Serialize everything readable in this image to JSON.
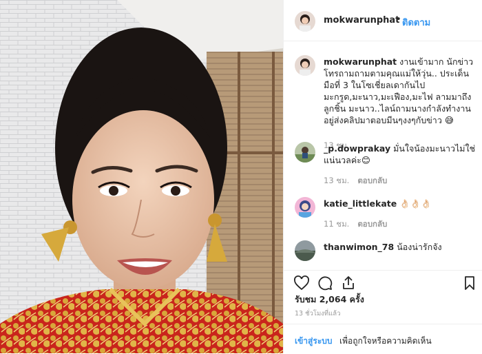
{
  "header": {
    "username": "mokwarunphat",
    "separator": "•",
    "follow_label": "ติดตาม"
  },
  "caption": {
    "username": "mokwarunphat",
    "text": "งานเข้ามาก นักข่าวโทรถามถามตามคุณแม่ให้วุ่น.. ประเด็นมือที่ 3 ในโซเชี่ยลเดากันไป มะกรูด,มะนาว,มะเฟือง,มะไฟ ลามมาถึงลูกชิ้น มะนาว..ไลน์ถามนางกำลังทำงานอยู่ส่งคลิปมาตอบมีนๆงงๆกับข่าว 😅",
    "time": "13 ชม."
  },
  "comments": [
    {
      "username": "_p.dowprakay",
      "text": "มั่นใจน้องมะนาวไม่ใช่แน่นวลค่ะ😊",
      "time": "13 ชม.",
      "reply_label": "ตอบกลับ"
    },
    {
      "username": "katie_littlekate",
      "text": "👌🏻👌🏻👌🏻",
      "time": "11 ชม.",
      "reply_label": "ตอบกลับ"
    },
    {
      "username": "thanwimon_78",
      "text": "น้องน่ารักจัง",
      "time": "",
      "reply_label": ""
    }
  ],
  "actions": {
    "like_icon": "heart-icon",
    "comment_icon": "comment-icon",
    "share_icon": "share-icon",
    "save_icon": "bookmark-icon",
    "likes_text": "รับชม 2,064 ครั้ง",
    "time_ago": "13 ชั่วโมงที่แล้ว"
  },
  "add_comment": {
    "login_label": "เข้าสู่ระบบ",
    "prompt_text": "เพื่อถูกใจหรือความคิดเห็น"
  },
  "colors": {
    "link_blue": "#3897f0",
    "text": "#262626",
    "muted": "#999999",
    "border": "#efefef"
  }
}
